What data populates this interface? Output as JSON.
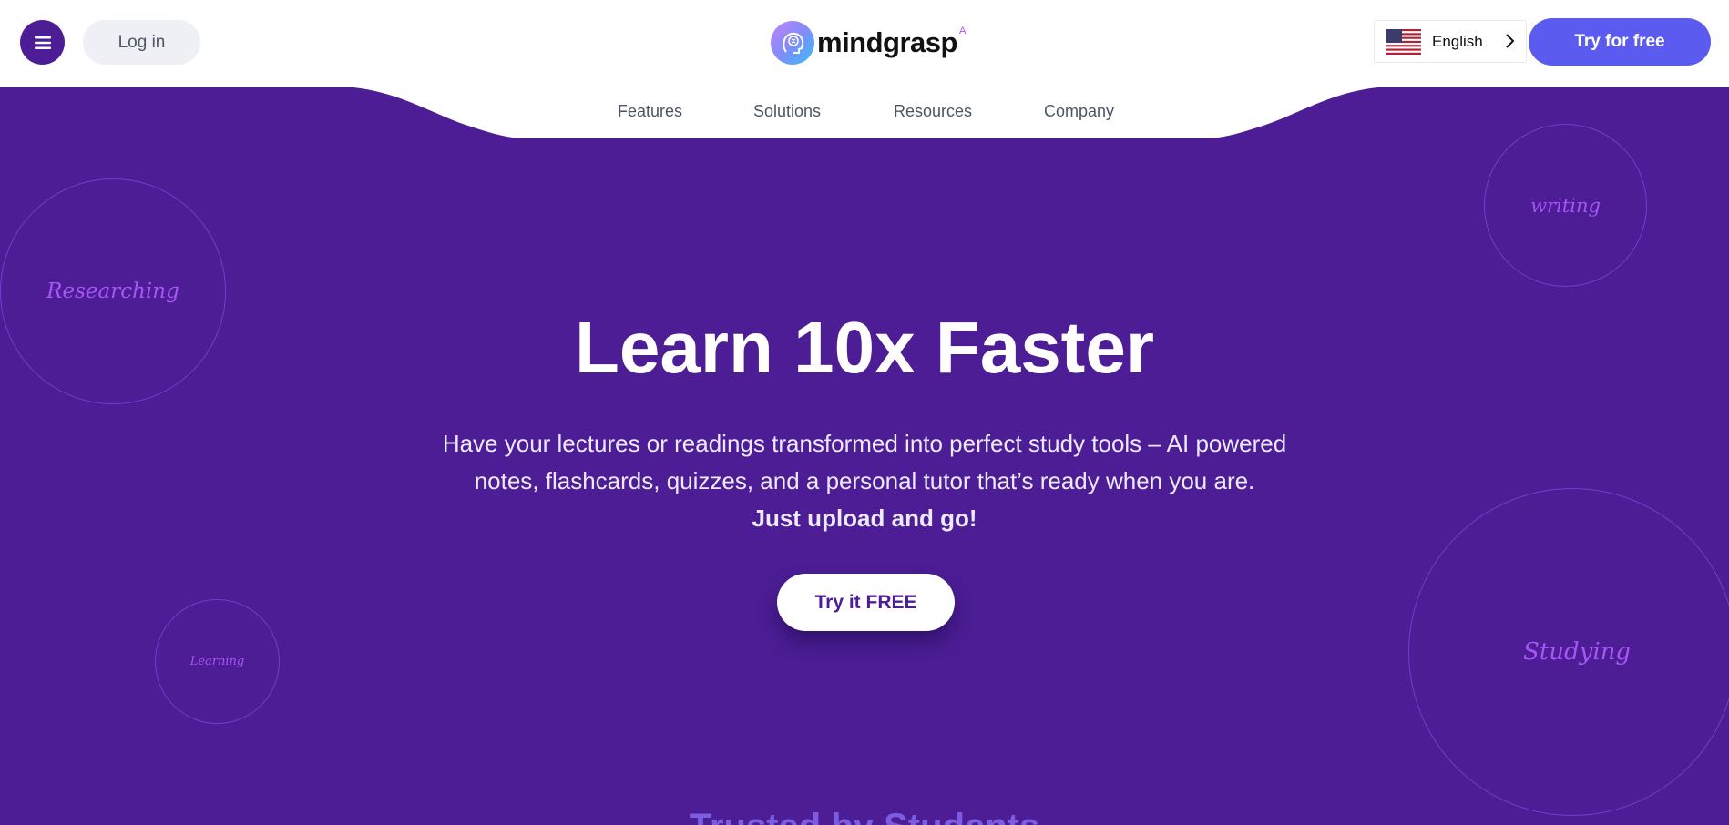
{
  "colors": {
    "brand_purple": "#4c1d95",
    "button_blue": "#5b5bf0",
    "accent_violet": "#a855f7"
  },
  "header": {
    "menu_icon": "hamburger-menu-icon",
    "login_label": "Log in",
    "logo_text": "mindgrasp",
    "logo_superscript": "Ai",
    "language": {
      "label": "English",
      "flag": "us-flag-icon",
      "icon": "chevron-right-icon"
    },
    "try_label": "Try for free"
  },
  "nav": {
    "items": [
      "Features",
      "Solutions",
      "Resources",
      "Company"
    ]
  },
  "decorations": {
    "researching": "Researching",
    "writing": "writing",
    "learning": "Learning",
    "studying": "Studying"
  },
  "hero": {
    "title": "Learn 10x Faster",
    "subtitle_line1": "Have your lectures or readings transformed into perfect study tools – AI powered",
    "subtitle_line2": "notes, flashcards, quizzes, and a personal tutor that’s ready when you are.",
    "subtitle_bold": "Just upload and go!",
    "cta_label": "Try it FREE"
  },
  "next_section_peek": "Trusted by Students"
}
